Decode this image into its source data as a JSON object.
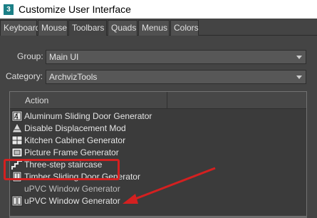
{
  "window": {
    "title": "Customize User Interface",
    "app_badge": "3"
  },
  "tabs": [
    {
      "label": "Keyboard",
      "active": false
    },
    {
      "label": "Mouse",
      "active": false
    },
    {
      "label": "Toolbars",
      "active": true
    },
    {
      "label": "Quads",
      "active": false
    },
    {
      "label": "Menus",
      "active": false
    },
    {
      "label": "Colors",
      "active": false
    }
  ],
  "group": {
    "label": "Group:",
    "value": "Main UI"
  },
  "category": {
    "label": "Category:",
    "value": "ArchvizTools"
  },
  "action_list": {
    "header": "Action",
    "items": [
      {
        "label": "Aluminum Sliding Door Generator",
        "icon": "sliding-door-icon"
      },
      {
        "label": "Disable Displacement Mod",
        "icon": "displacement-icon"
      },
      {
        "label": "Kitchen Cabinet Generator",
        "icon": "cabinet-icon"
      },
      {
        "label": "Picture Frame Generator",
        "icon": "picture-frame-icon"
      },
      {
        "label": "Three-step staircase",
        "icon": "staircase-icon"
      },
      {
        "label": "Timber Sliding Door Generator",
        "icon": "timber-door-icon"
      },
      {
        "label": "uPVC Window Generator",
        "icon": ""
      },
      {
        "label": "uPVC Window Generator",
        "icon": "window-icon"
      }
    ]
  },
  "annotation": {
    "highlight_color": "#d42020"
  }
}
